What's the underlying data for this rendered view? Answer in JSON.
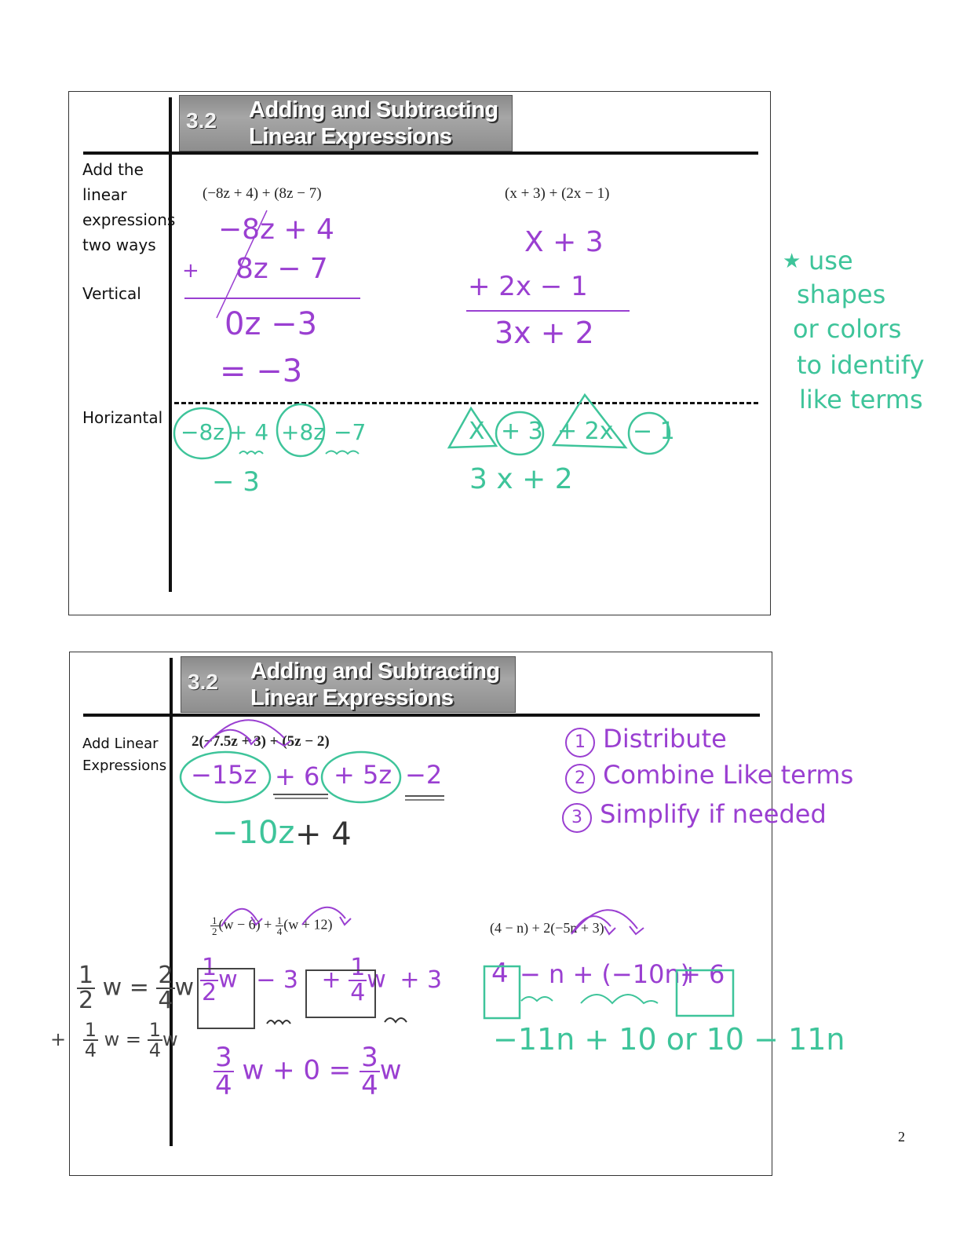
{
  "page_number": "2",
  "slide1": {
    "banner": {
      "number": "3.2",
      "title_line1": "Adding and Subtracting",
      "title_line2": "Linear Expressions"
    },
    "side_labels": {
      "instruction_l1": "Add the",
      "instruction_l2": "linear",
      "instruction_l3": "expressions",
      "instruction_l4": "two ways",
      "vertical": "Vertical",
      "horizontal": "Horizantal"
    },
    "problem1": {
      "printed": "(−8z + 4) + (8z − 7)",
      "vertical_work": {
        "line1": "−8z + 4",
        "line2_op": "+",
        "line2": "8z − 7",
        "result": "0z  −3",
        "final": "= −3"
      },
      "horizontal_work": {
        "terms": [
          "−8z",
          "+ 4",
          "+8z",
          "−7"
        ],
        "result": "− 3"
      }
    },
    "problem2": {
      "printed": "(x + 3) + (2x − 1)",
      "vertical_work": {
        "line1": "X + 3",
        "line2": "+  2x − 1",
        "result": "3x + 2"
      },
      "horizontal_work": {
        "terms": [
          "X",
          "+ 3",
          "+ 2x",
          "− 1"
        ],
        "result": "3 x + 2"
      }
    },
    "side_note": {
      "star": "★",
      "lines": [
        "use",
        "shapes",
        "or colors",
        "to identify",
        "like terms"
      ]
    }
  },
  "slide2": {
    "banner": {
      "number": "3.2",
      "title_line1": "Adding and Subtracting",
      "title_line2": "Linear Expressions"
    },
    "side_labels": {
      "l1": "Add Linear",
      "l2": "Expressions"
    },
    "problem1": {
      "printed": "2(−7.5z + 3) + (5z − 2)",
      "work": {
        "t1": "−15z",
        "t2": "+ 6",
        "t3": "+ 5z",
        "t4": "−2"
      },
      "result": {
        "part1": "−10z",
        "part2": "+ 4"
      }
    },
    "steps": [
      {
        "num": "1",
        "text": "Distribute"
      },
      {
        "num": "2",
        "text": "Combine Like terms"
      },
      {
        "num": "3",
        "text": "Simplify if needed"
      }
    ],
    "problem2": {
      "printed_coef1": {
        "n": "1",
        "d": "2"
      },
      "printed_part1": "(w − 6) +",
      "printed_coef2": {
        "n": "1",
        "d": "4"
      },
      "printed_part2": "(w + 12)",
      "work": {
        "t1_n": "1",
        "t1_d": "2",
        "t1_var": "w",
        "t2": "− 3",
        "t3_sign": "+",
        "t3_n": "1",
        "t3_d": "4",
        "t3_var": "w",
        "t4": "+ 3"
      },
      "result": {
        "n": "3",
        "d": "4",
        "mid": "w  + 0 =",
        "n2": "3",
        "d2": "4",
        "var": "w"
      },
      "margin_work": {
        "row1": {
          "n": "1",
          "d": "2",
          "mid": "w =",
          "n2": "2",
          "d2": "4",
          "var": "w"
        },
        "row2": {
          "op": "+",
          "n": "1",
          "d": "4",
          "mid": "w =",
          "n2": "1",
          "d2": "4",
          "var": "w"
        }
      }
    },
    "problem3": {
      "printed": "(4 − n) + 2(−5n + 3)",
      "work": {
        "t1": "4",
        "t2": "− n  + (−10n)",
        "t3": "+ 6"
      },
      "result": "−11n + 10  or  10 − 11n"
    }
  },
  "colors": {
    "purple_ink": "#9a3fd1",
    "teal_ink": "#3ec49a",
    "banner_gray": "#9a9a9a"
  }
}
